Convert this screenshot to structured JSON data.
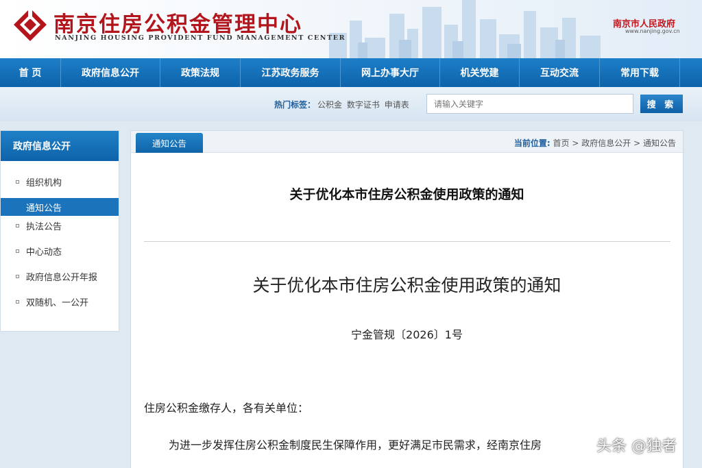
{
  "header": {
    "site_title": "南京住房公积金管理中心",
    "site_subtitle": "NANJING HOUSING PROVIDENT FUND MANAGEMENT CENTER",
    "gov_name": "南京市人民政府",
    "gov_url": "www.nanjing.gov.cn",
    "brand_color": "#b2161c"
  },
  "nav": {
    "items": [
      "首 页",
      "政府信息公开",
      "政策法规",
      "江苏政务服务",
      "网上办事大厅",
      "机关党建",
      "互动交流",
      "常用下载"
    ]
  },
  "search": {
    "hot_label": "热门标签：",
    "hot_tags": [
      "公积金",
      "数字证书",
      "申请表"
    ],
    "placeholder": "请输入关键字",
    "button_label": "搜 索"
  },
  "sidebar": {
    "title": "政府信息公开",
    "items": [
      {
        "label": "组织机构",
        "active": false
      },
      {
        "label": "通知公告",
        "active": true
      },
      {
        "label": "执法公告",
        "active": false
      },
      {
        "label": "中心动态",
        "active": false
      },
      {
        "label": "政府信息公开年报",
        "active": false
      },
      {
        "label": "双随机、一公开",
        "active": false
      }
    ]
  },
  "main": {
    "tab_label": "通知公告",
    "breadcrumb": {
      "label": "当前位置:",
      "items": [
        "首页",
        "政府信息公开",
        "通知公告"
      ],
      "separator": ">"
    },
    "page_title": "关于优化本市住房公积金使用政策的通知",
    "doc_title": "关于优化本市住房公积金使用政策的通知",
    "doc_number": "宁金管规〔2026〕1号",
    "salutation": "住房公积金缴存人，各有关单位：",
    "body_first_line": "为进一步发挥住房公积金制度民生保障作用，更好满足市民需求，经南京住房"
  },
  "watermark": "头条 @独者",
  "colors": {
    "nav_blue": "#0d63aa",
    "active_item": "#1a73bb",
    "accent_red": "#c0161c"
  }
}
